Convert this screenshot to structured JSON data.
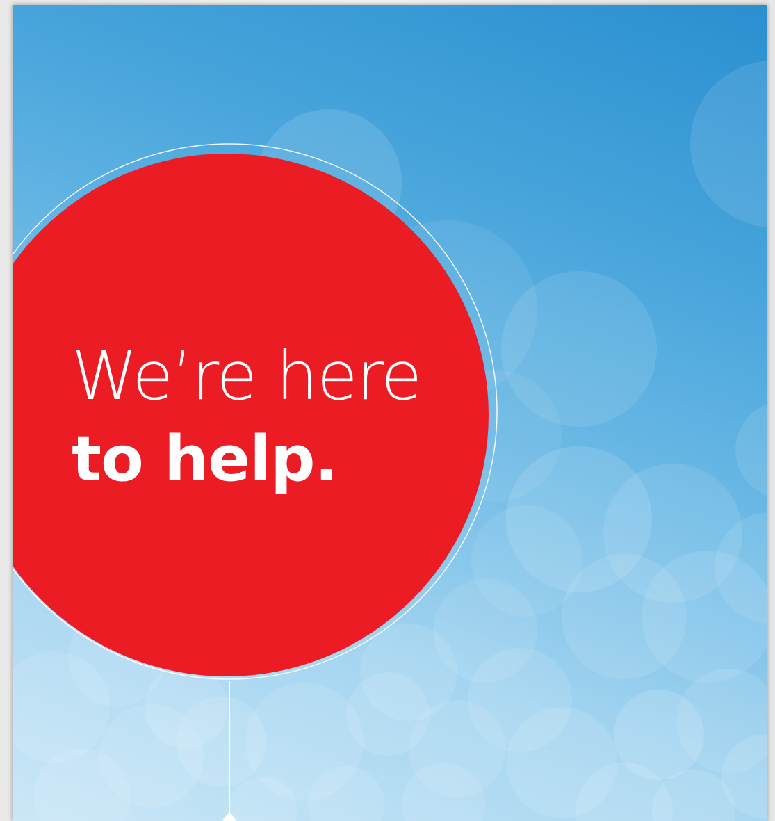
{
  "headline": {
    "line1": "We’re here",
    "line2": "to help."
  },
  "colors": {
    "accent_red": "#ec1c24",
    "sky_blue_dark": "#2a8fd0",
    "sky_blue_light": "#cbe7f7",
    "text": "#ffffff"
  }
}
